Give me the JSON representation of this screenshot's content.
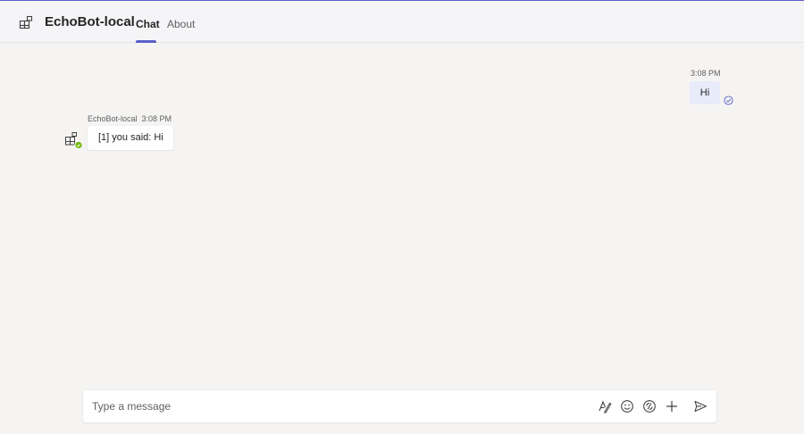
{
  "header": {
    "title": "EchoBot-local",
    "app_icon": "apps-icon",
    "tabs": [
      {
        "label": "Chat",
        "active": true
      },
      {
        "label": "About",
        "active": false
      }
    ]
  },
  "messages": {
    "sent": {
      "time": "3:08 PM",
      "text": "Hi",
      "status_icon": "read-check-icon"
    },
    "received": {
      "sender": "EchoBot-local",
      "time": "3:08 PM",
      "text": "[1] you said: Hi",
      "avatar_icon": "bot-apps-icon",
      "presence": "available"
    }
  },
  "composer": {
    "placeholder": "Type a message",
    "value": "",
    "actions": [
      "format-icon",
      "emoji-icon",
      "loop-icon",
      "add-icon",
      "send-icon"
    ]
  },
  "colors": {
    "accent": "#5b5fc7",
    "sent_bubble": "#e8ebfa",
    "presence_available": "#6bb700",
    "background": "#f5f4f3"
  }
}
